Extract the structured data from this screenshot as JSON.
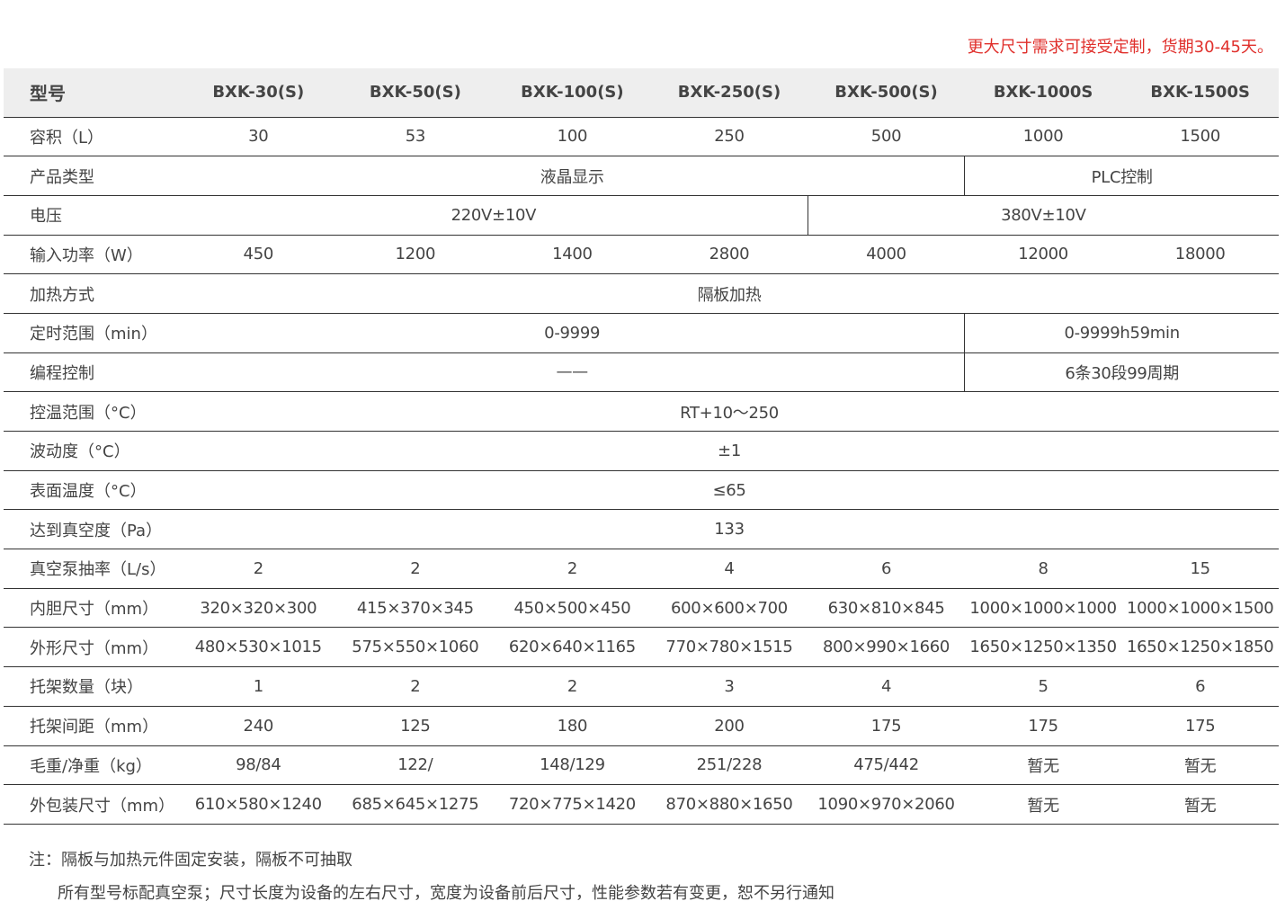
{
  "notice": "更大尺寸需求可接受定制，货期30-45天。",
  "header": {
    "label": "型号",
    "models": [
      "BXK-30(S)",
      "BXK-50(S)",
      "BXK-100(S)",
      "BXK-250(S)",
      "BXK-500(S)",
      "BXK-1000S",
      "BXK-1500S"
    ]
  },
  "rows": {
    "volume": {
      "label": "容积（L）",
      "values": [
        "30",
        "53",
        "100",
        "250",
        "500",
        "1000",
        "1500"
      ]
    },
    "product_type": {
      "label": "产品类型",
      "a": "液晶显示",
      "b": "PLC控制"
    },
    "voltage": {
      "label": "电压",
      "a": "220V±10V",
      "b": "380V±10V"
    },
    "power": {
      "label": "输入功率（W）",
      "values": [
        "450",
        "1200",
        "1400",
        "2800",
        "4000",
        "12000",
        "18000"
      ]
    },
    "heating": {
      "label": "加热方式",
      "value": "隔板加热"
    },
    "timer": {
      "label": "定时范围（min）",
      "a": "0-9999",
      "b": "0-9999h59min"
    },
    "program": {
      "label": "编程控制",
      "a": "——",
      "b": "6条30段99周期"
    },
    "temp_range": {
      "label": "控温范围（°C）",
      "value": "RT+10～250"
    },
    "fluctuation": {
      "label": "波动度（°C）",
      "value": "±1"
    },
    "surface_temp": {
      "label": "表面温度（°C）",
      "value": "≤65"
    },
    "vacuum": {
      "label": "达到真空度（Pa）",
      "value": "133"
    },
    "pump_rate": {
      "label": "真空泵抽率（L/s）",
      "values": [
        "2",
        "2",
        "2",
        "4",
        "6",
        "8",
        "15"
      ]
    },
    "inner_size": {
      "label": "内胆尺寸（mm）",
      "values": [
        "320×320×300",
        "415×370×345",
        "450×500×450",
        "600×600×700",
        "630×810×845",
        "1000×1000×1000",
        "1000×1000×1500"
      ]
    },
    "outer_size": {
      "label": "外形尺寸（mm）",
      "values": [
        "480×530×1015",
        "575×550×1060",
        "620×640×1165",
        "770×780×1515",
        "800×990×1660",
        "1650×1250×1350",
        "1650×1250×1850"
      ]
    },
    "shelf_count": {
      "label": "托架数量（块）",
      "values": [
        "1",
        "2",
        "2",
        "3",
        "4",
        "5",
        "6"
      ]
    },
    "shelf_spacing": {
      "label": "托架间距（mm）",
      "values": [
        "240",
        "125",
        "180",
        "200",
        "175",
        "175",
        "175"
      ]
    },
    "weight": {
      "label": "毛重/净重（kg）",
      "values": [
        "98/84",
        "122/",
        "148/129",
        "251/228",
        "475/442",
        "暂无",
        "暂无"
      ]
    },
    "package": {
      "label": "外包装尺寸（mm）",
      "values": [
        "610×580×1240",
        "685×645×1275",
        "720×775×1420",
        "870×880×1650",
        "1090×970×2060",
        "暂无",
        "暂无"
      ]
    }
  },
  "notes": {
    "line1": "注：隔板与加热元件固定安装，隔板不可抽取",
    "line2": "所有型号标配真空泵；尺寸长度为设备的左右尺寸，宽度为设备前后尺寸，性能参数若有变更，恕不另行通知"
  },
  "colors": {
    "notice": "#e0302c",
    "header_bg": "#eeeeee",
    "rule": "#333333",
    "text": "#444444"
  }
}
